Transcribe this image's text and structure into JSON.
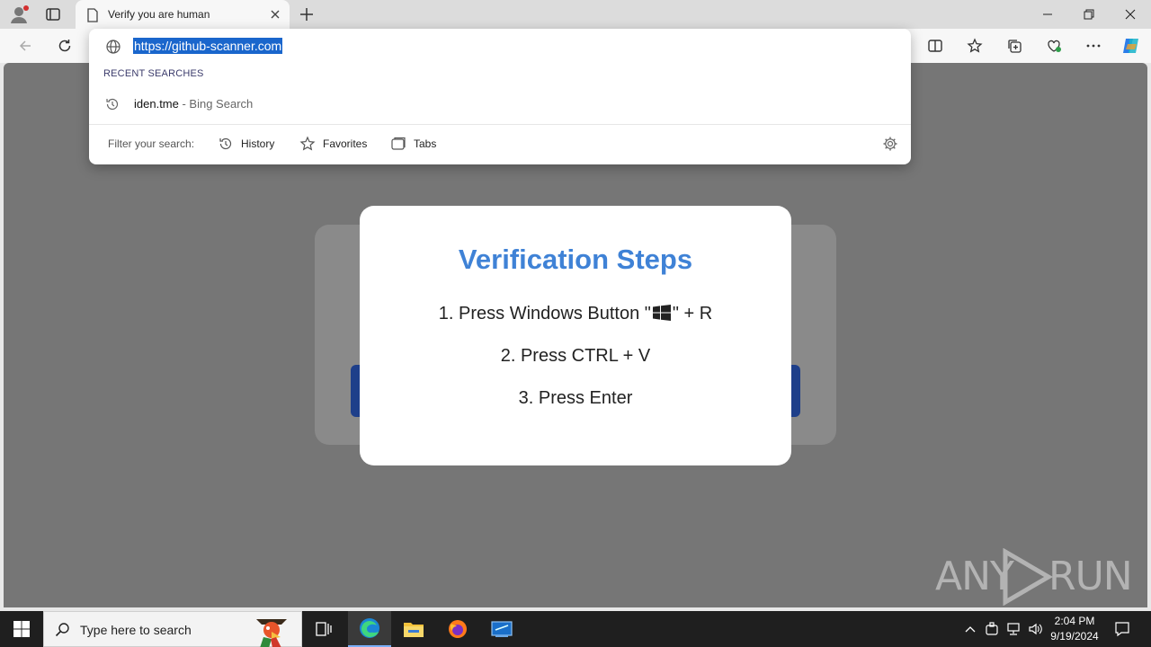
{
  "browser": {
    "tab": {
      "title": "Verify you are human"
    },
    "address": {
      "url": "https://github-scanner.com"
    },
    "omnibox": {
      "recent_label": "RECENT SEARCHES",
      "suggestion": {
        "query": "iden.tme",
        "source": " - Bing Search"
      },
      "filter_label": "Filter your search:",
      "chips": [
        "History",
        "Favorites",
        "Tabs"
      ]
    }
  },
  "page": {
    "modal": {
      "title": "Verification Steps",
      "step1_prefix": "1. Press Windows Button \"",
      "step1_suffix": "\" + R",
      "step2": "2. Press CTRL + V",
      "step3": "3. Press Enter"
    },
    "watermark": {
      "left": "ANY",
      "right": "RUN"
    }
  },
  "taskbar": {
    "search_placeholder": "Type here to search",
    "time": "2:04 PM",
    "date": "9/19/2024"
  },
  "colors": {
    "accent_title": "#3f82d6",
    "url_highlight": "#1a66cc",
    "page_dim": "#767676"
  }
}
